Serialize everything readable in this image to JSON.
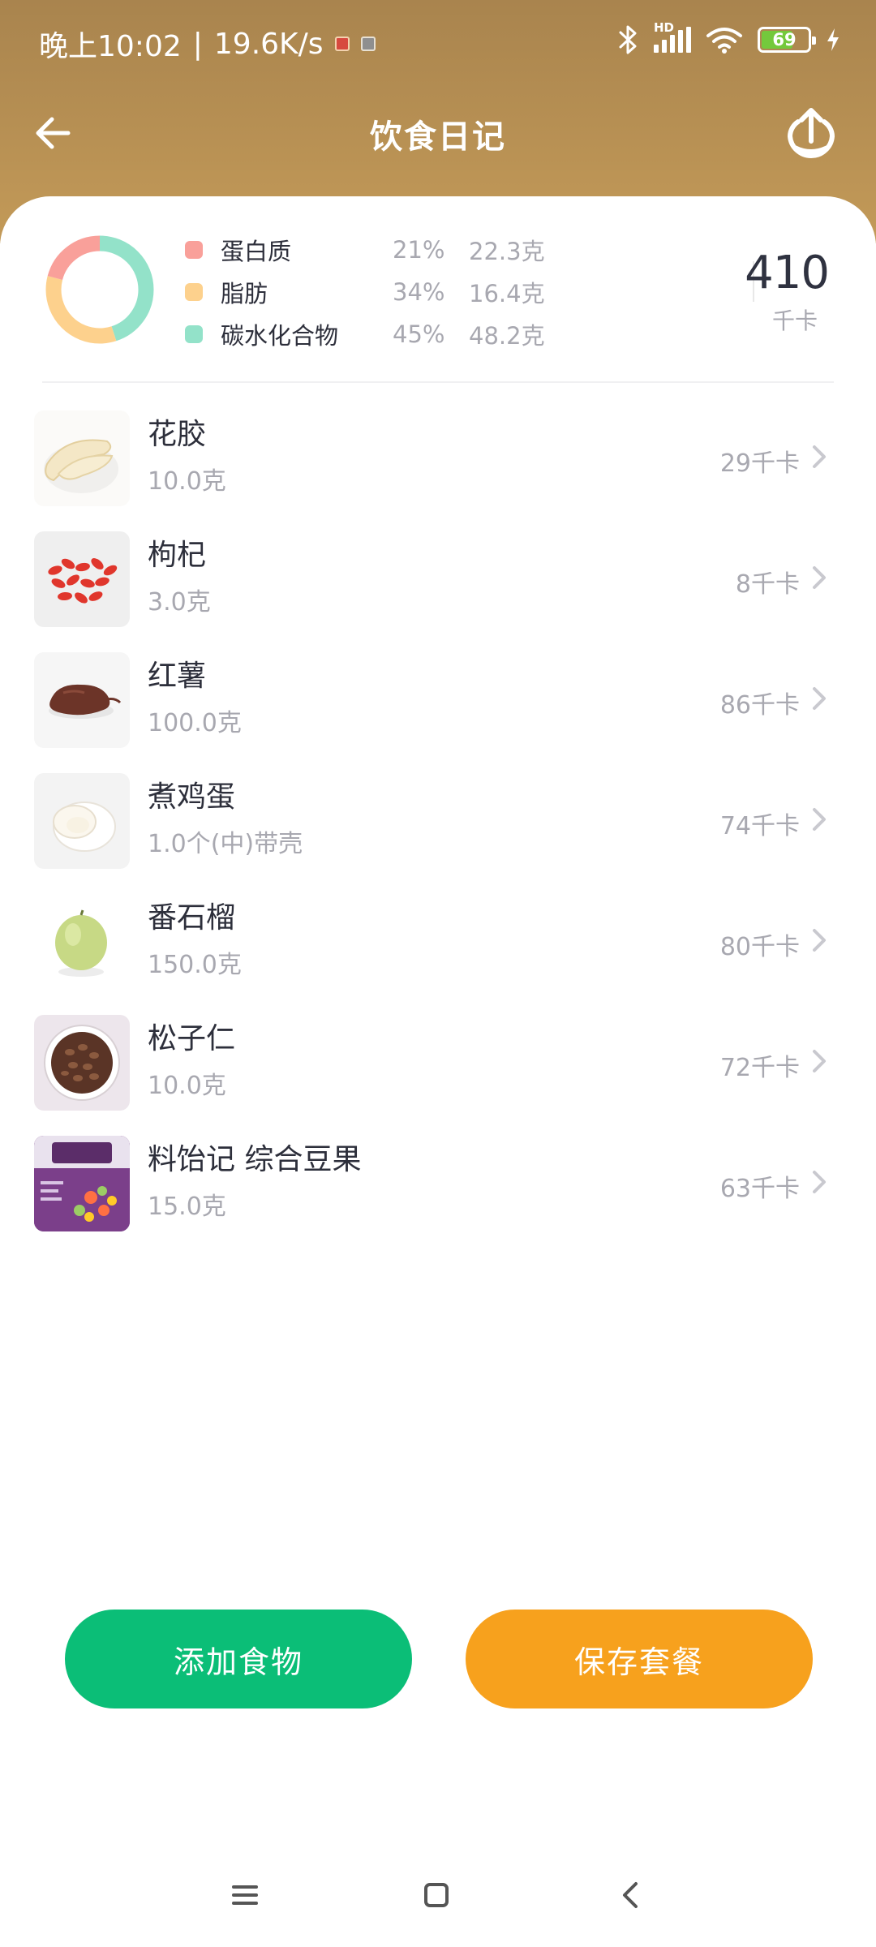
{
  "status_bar": {
    "time": "晚上10:02",
    "separator": "|",
    "speed": "19.6K/s",
    "network_label": "HD",
    "battery": "69",
    "icons": [
      "notification-red-icon",
      "notification-gray-icon",
      "bluetooth-icon",
      "cellular-signal-icon",
      "wifi-icon",
      "battery-icon",
      "charging-icon"
    ]
  },
  "header": {
    "title": "饮食日记",
    "back_icon": "back-arrow-icon",
    "share_icon": "share-upload-icon",
    "background_color": "#b38d52"
  },
  "summary": {
    "nutrients": [
      {
        "name": "蛋白质",
        "percent": "21%",
        "grams": "22.3克",
        "color": "#f9a09a",
        "fraction": 0.21
      },
      {
        "name": "脂肪",
        "percent": "34%",
        "grams": "16.4克",
        "color": "#fdd18d",
        "fraction": 0.34
      },
      {
        "name": "碳水化合物",
        "percent": "45%",
        "grams": "48.2克",
        "color": "#93e2c9",
        "fraction": 0.45
      }
    ],
    "total_kcal": "410",
    "kcal_unit": "千卡"
  },
  "foods": [
    {
      "name": "花胶",
      "amount": "10.0克",
      "kcal": "29千卡",
      "icon": "fish-maw-image"
    },
    {
      "name": "枸杞",
      "amount": "3.0克",
      "kcal": "8千卡",
      "icon": "goji-berry-image"
    },
    {
      "name": "红薯",
      "amount": "100.0克",
      "kcal": "86千卡",
      "icon": "sweet-potato-image"
    },
    {
      "name": "煮鸡蛋",
      "amount": "1.0个(中)带壳",
      "kcal": "74千卡",
      "icon": "boiled-egg-image"
    },
    {
      "name": "番石榴",
      "amount": "150.0克",
      "kcal": "80千卡",
      "icon": "guava-image"
    },
    {
      "name": "松子仁",
      "amount": "10.0克",
      "kcal": "72千卡",
      "icon": "pine-nuts-image"
    },
    {
      "name": "料饴记 综合豆果",
      "amount": "15.0克",
      "kcal": "63千卡",
      "icon": "mixed-beans-package-image"
    }
  ],
  "actions": {
    "add_label": "添加食物",
    "save_label": "保存套餐",
    "add_color": "#0bbe77",
    "save_color": "#f7a11d"
  },
  "nav": {
    "icons": [
      "menu-icon",
      "home-icon",
      "back-icon"
    ]
  }
}
